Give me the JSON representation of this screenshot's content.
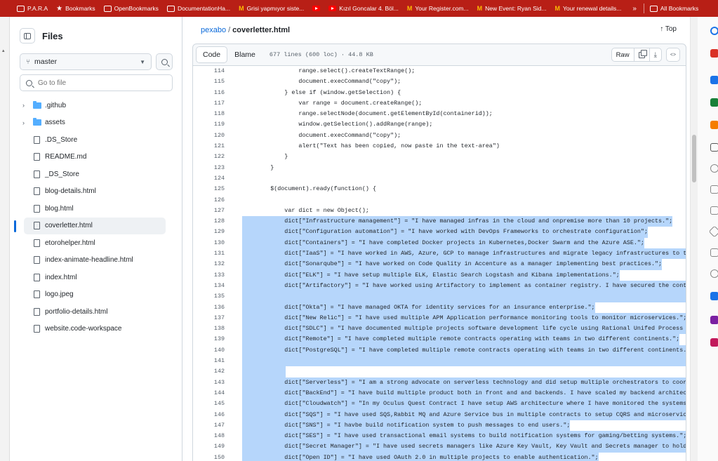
{
  "bookmarks": {
    "items": [
      {
        "label": "P.A.R.A",
        "icon": "folder-icon"
      },
      {
        "label": "Bookmarks",
        "icon": "star-icon"
      },
      {
        "label": "OpenBookmarks",
        "icon": "folder-icon"
      },
      {
        "label": "DocumentationHa...",
        "icon": "folder-icon"
      },
      {
        "label": "Grisi yapmıyor siste...",
        "icon": "gmail-icon"
      },
      {
        "label": "",
        "icon": "youtube-icon"
      },
      {
        "label": "Kızıl Goncalar 4. Böl...",
        "icon": "youtube-icon"
      },
      {
        "label": "Your Register.com...",
        "icon": "gmail-icon"
      },
      {
        "label": "New Event: Ryan Sid...",
        "icon": "gmail-icon"
      },
      {
        "label": "Your renewal details...",
        "icon": "gmail-icon"
      }
    ],
    "more": "»",
    "all": "All Bookmarks"
  },
  "sidebar": {
    "title": "Files",
    "branch": "master",
    "goto_placeholder": "Go to file",
    "items": [
      {
        "label": ".github",
        "type": "folder"
      },
      {
        "label": "assets",
        "type": "folder"
      },
      {
        "label": ".DS_Store",
        "type": "file"
      },
      {
        "label": "README.md",
        "type": "file"
      },
      {
        "label": "_DS_Store",
        "type": "file"
      },
      {
        "label": "blog-details.html",
        "type": "file"
      },
      {
        "label": "blog.html",
        "type": "file"
      },
      {
        "label": "coverletter.html",
        "type": "file",
        "selected": true
      },
      {
        "label": "etorohelper.html",
        "type": "file"
      },
      {
        "label": "index-animate-headline.html",
        "type": "file"
      },
      {
        "label": "index.html",
        "type": "file"
      },
      {
        "label": "logo.jpeg",
        "type": "file"
      },
      {
        "label": "portfolio-details.html",
        "type": "file"
      },
      {
        "label": "website.code-workspace",
        "type": "file"
      }
    ]
  },
  "breadcrumb": {
    "repo": "pexabo",
    "sep": "/",
    "file": "coverletter.html"
  },
  "top_link": "Top",
  "file_bar": {
    "code_label": "Code",
    "blame_label": "Blame",
    "meta": "677 lines (600 loc) · 44.8 KB",
    "raw_label": "Raw"
  },
  "code": [
    {
      "n": "114",
      "t": "                range.select().createTextRange();",
      "sel": false
    },
    {
      "n": "115",
      "t": "                document.execCommand(\"copy\");",
      "sel": false
    },
    {
      "n": "116",
      "t": "            } else if (window.getSelection) {",
      "sel": false
    },
    {
      "n": "117",
      "t": "                var range = document.createRange();",
      "sel": false
    },
    {
      "n": "118",
      "t": "                range.selectNode(document.getElementById(containerid));",
      "sel": false
    },
    {
      "n": "119",
      "t": "                window.getSelection().addRange(range);",
      "sel": false
    },
    {
      "n": "120",
      "t": "                document.execCommand(\"copy\");",
      "sel": false
    },
    {
      "n": "121",
      "t": "                alert(\"Text has been copied, now paste in the text-area\")",
      "sel": false
    },
    {
      "n": "122",
      "t": "            }",
      "sel": false
    },
    {
      "n": "123",
      "t": "        }",
      "sel": false
    },
    {
      "n": "124",
      "t": "",
      "sel": false
    },
    {
      "n": "125",
      "t": "        $(document).ready(function() {",
      "sel": false
    },
    {
      "n": "126",
      "t": "",
      "sel": false
    },
    {
      "n": "127",
      "t": "            var dict = new Object();",
      "sel": false
    },
    {
      "n": "128",
      "t": "            dict[\"Infrastructure management\"] = \"I have managed infras in the cloud and onpremise more than 10 projects.\";",
      "sel": true
    },
    {
      "n": "129",
      "t": "            dict[\"Configuration automation\"] = \"I have worked with DevOps Frameworks to orchestrate configuration\";",
      "sel": true
    },
    {
      "n": "130",
      "t": "            dict[\"Containers\"] = \"I have completed Docker projects in Kubernetes,Docker Swarm and the Azure ASE.\";",
      "sel": true
    },
    {
      "n": "131",
      "t": "            dict[\"IaaS\"] = \"I have worked in AWS, Azure, GCP to manage infrastructures and migrate legacy infrastructures to the cl",
      "sel": true
    },
    {
      "n": "132",
      "t": "            dict[\"Sonarqube\"] = \"I have worked on Code Quality in Accenture as a manager implementing best practices.\";",
      "sel": true
    },
    {
      "n": "133",
      "t": "            dict[\"ELK\"] = \"I have setup multiple ELK, Elastic Search Logstash and Kibana implementations.\";",
      "sel": true
    },
    {
      "n": "134",
      "t": "            dict[\"Artifactory\"] = \"I have worked using Artifactory to implement as container registry. I have secured the container",
      "sel": true
    },
    {
      "n": "135",
      "t": "",
      "sel": true
    },
    {
      "n": "136",
      "t": "            dict[\"Okta\"] = \"I have managed OKTA for identity services for an insurance enterprise.\";",
      "sel": true
    },
    {
      "n": "137",
      "t": "            dict[\"New Relic\"] = \"I have used multiple APM Application performance monitoring tools to monitor microservices.\";",
      "sel": true
    },
    {
      "n": "138",
      "t": "            dict[\"SDLC\"] = \"I have documented multiple projects software development life cycle using Rational Unifed Process based",
      "sel": true
    },
    {
      "n": "139",
      "t": "            dict[\"Remote\"] = \"I have completed multiple remote contracts operating with teams in two different continents.\";",
      "sel": true
    },
    {
      "n": "140",
      "t": "            dict[\"PostgreSQL\"] = \"I have completed multiple remote contracts operating with teams in two different continents.\";",
      "sel": true
    },
    {
      "n": "141",
      "t": "",
      "sel": true
    },
    {
      "n": "142",
      "t": "            ",
      "sel": true
    },
    {
      "n": "143",
      "t": "            dict[\"Serverless\"] = \"I am a strong advocate on serverless technology and did setup multiple orchestrators to coordinat",
      "sel": true
    },
    {
      "n": "144",
      "t": "            dict[\"BackEnd\"] = \"I have build multiple product both in front and and backends. I have scaled my backend architectures",
      "sel": true
    },
    {
      "n": "145",
      "t": "            dict[\"Cloudwatch\"] = \"In my Oculus Quest Contract I have setup AWS architecture where I have monitored the systems over",
      "sel": true
    },
    {
      "n": "146",
      "t": "            dict[\"SQS\"] = \"I have used SQS,Rabbit MQ and Azure Service bus in multiple contracts to setup CQRS and microservices ar",
      "sel": true
    },
    {
      "n": "147",
      "t": "            dict[\"SNS\"] = \"I havbe build notification system to push messages to end users.\";",
      "sel": true
    },
    {
      "n": "148",
      "t": "            dict[\"SES\"] = \"I have used transactional email systems to build notification systems for gaming/betting systems.\";",
      "sel": true
    },
    {
      "n": "149",
      "t": "            dict[\"Secret Manager\"] = \"I have used secrets managers like Azure Key Vault, Key Vault and Secrets manager to hold keys",
      "sel": true
    },
    {
      "n": "150",
      "t": "            dict[\"Open ID\"] = \"I have used OAuth 2.0 in multiple projects to enable authentication.\";",
      "sel": true
    }
  ]
}
